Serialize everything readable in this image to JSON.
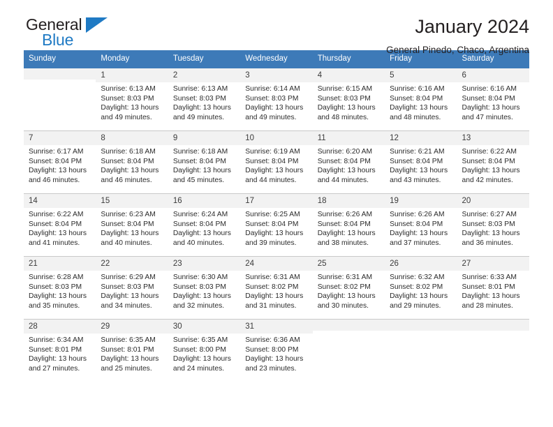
{
  "brand": {
    "name_top": "General",
    "name_bottom": "Blue",
    "accent_color": "#1f7ac4"
  },
  "header": {
    "title": "January 2024",
    "subtitle": "General Pinedo, Chaco, Argentina",
    "header_bg_color": "#3d7ab8",
    "daynum_bg_color": "#f2f2f2"
  },
  "weekdays": [
    "Sunday",
    "Monday",
    "Tuesday",
    "Wednesday",
    "Thursday",
    "Friday",
    "Saturday"
  ],
  "labels": {
    "sunrise_prefix": "Sunrise:",
    "sunset_prefix": "Sunset:",
    "daylight_prefix": "Daylight:"
  },
  "weeks": [
    [
      {
        "day": "",
        "sunrise": "",
        "sunset": "",
        "daylight_line1": "",
        "daylight_line2": "",
        "blank": true
      },
      {
        "day": "1",
        "sunrise": "Sunrise: 6:13 AM",
        "sunset": "Sunset: 8:03 PM",
        "daylight_line1": "Daylight: 13 hours",
        "daylight_line2": "and 49 minutes."
      },
      {
        "day": "2",
        "sunrise": "Sunrise: 6:13 AM",
        "sunset": "Sunset: 8:03 PM",
        "daylight_line1": "Daylight: 13 hours",
        "daylight_line2": "and 49 minutes."
      },
      {
        "day": "3",
        "sunrise": "Sunrise: 6:14 AM",
        "sunset": "Sunset: 8:03 PM",
        "daylight_line1": "Daylight: 13 hours",
        "daylight_line2": "and 49 minutes."
      },
      {
        "day": "4",
        "sunrise": "Sunrise: 6:15 AM",
        "sunset": "Sunset: 8:03 PM",
        "daylight_line1": "Daylight: 13 hours",
        "daylight_line2": "and 48 minutes."
      },
      {
        "day": "5",
        "sunrise": "Sunrise: 6:16 AM",
        "sunset": "Sunset: 8:04 PM",
        "daylight_line1": "Daylight: 13 hours",
        "daylight_line2": "and 48 minutes."
      },
      {
        "day": "6",
        "sunrise": "Sunrise: 6:16 AM",
        "sunset": "Sunset: 8:04 PM",
        "daylight_line1": "Daylight: 13 hours",
        "daylight_line2": "and 47 minutes."
      }
    ],
    [
      {
        "day": "7",
        "sunrise": "Sunrise: 6:17 AM",
        "sunset": "Sunset: 8:04 PM",
        "daylight_line1": "Daylight: 13 hours",
        "daylight_line2": "and 46 minutes."
      },
      {
        "day": "8",
        "sunrise": "Sunrise: 6:18 AM",
        "sunset": "Sunset: 8:04 PM",
        "daylight_line1": "Daylight: 13 hours",
        "daylight_line2": "and 46 minutes."
      },
      {
        "day": "9",
        "sunrise": "Sunrise: 6:18 AM",
        "sunset": "Sunset: 8:04 PM",
        "daylight_line1": "Daylight: 13 hours",
        "daylight_line2": "and 45 minutes."
      },
      {
        "day": "10",
        "sunrise": "Sunrise: 6:19 AM",
        "sunset": "Sunset: 8:04 PM",
        "daylight_line1": "Daylight: 13 hours",
        "daylight_line2": "and 44 minutes."
      },
      {
        "day": "11",
        "sunrise": "Sunrise: 6:20 AM",
        "sunset": "Sunset: 8:04 PM",
        "daylight_line1": "Daylight: 13 hours",
        "daylight_line2": "and 44 minutes."
      },
      {
        "day": "12",
        "sunrise": "Sunrise: 6:21 AM",
        "sunset": "Sunset: 8:04 PM",
        "daylight_line1": "Daylight: 13 hours",
        "daylight_line2": "and 43 minutes."
      },
      {
        "day": "13",
        "sunrise": "Sunrise: 6:22 AM",
        "sunset": "Sunset: 8:04 PM",
        "daylight_line1": "Daylight: 13 hours",
        "daylight_line2": "and 42 minutes."
      }
    ],
    [
      {
        "day": "14",
        "sunrise": "Sunrise: 6:22 AM",
        "sunset": "Sunset: 8:04 PM",
        "daylight_line1": "Daylight: 13 hours",
        "daylight_line2": "and 41 minutes."
      },
      {
        "day": "15",
        "sunrise": "Sunrise: 6:23 AM",
        "sunset": "Sunset: 8:04 PM",
        "daylight_line1": "Daylight: 13 hours",
        "daylight_line2": "and 40 minutes."
      },
      {
        "day": "16",
        "sunrise": "Sunrise: 6:24 AM",
        "sunset": "Sunset: 8:04 PM",
        "daylight_line1": "Daylight: 13 hours",
        "daylight_line2": "and 40 minutes."
      },
      {
        "day": "17",
        "sunrise": "Sunrise: 6:25 AM",
        "sunset": "Sunset: 8:04 PM",
        "daylight_line1": "Daylight: 13 hours",
        "daylight_line2": "and 39 minutes."
      },
      {
        "day": "18",
        "sunrise": "Sunrise: 6:26 AM",
        "sunset": "Sunset: 8:04 PM",
        "daylight_line1": "Daylight: 13 hours",
        "daylight_line2": "and 38 minutes."
      },
      {
        "day": "19",
        "sunrise": "Sunrise: 6:26 AM",
        "sunset": "Sunset: 8:04 PM",
        "daylight_line1": "Daylight: 13 hours",
        "daylight_line2": "and 37 minutes."
      },
      {
        "day": "20",
        "sunrise": "Sunrise: 6:27 AM",
        "sunset": "Sunset: 8:03 PM",
        "daylight_line1": "Daylight: 13 hours",
        "daylight_line2": "and 36 minutes."
      }
    ],
    [
      {
        "day": "21",
        "sunrise": "Sunrise: 6:28 AM",
        "sunset": "Sunset: 8:03 PM",
        "daylight_line1": "Daylight: 13 hours",
        "daylight_line2": "and 35 minutes."
      },
      {
        "day": "22",
        "sunrise": "Sunrise: 6:29 AM",
        "sunset": "Sunset: 8:03 PM",
        "daylight_line1": "Daylight: 13 hours",
        "daylight_line2": "and 34 minutes."
      },
      {
        "day": "23",
        "sunrise": "Sunrise: 6:30 AM",
        "sunset": "Sunset: 8:03 PM",
        "daylight_line1": "Daylight: 13 hours",
        "daylight_line2": "and 32 minutes."
      },
      {
        "day": "24",
        "sunrise": "Sunrise: 6:31 AM",
        "sunset": "Sunset: 8:02 PM",
        "daylight_line1": "Daylight: 13 hours",
        "daylight_line2": "and 31 minutes."
      },
      {
        "day": "25",
        "sunrise": "Sunrise: 6:31 AM",
        "sunset": "Sunset: 8:02 PM",
        "daylight_line1": "Daylight: 13 hours",
        "daylight_line2": "and 30 minutes."
      },
      {
        "day": "26",
        "sunrise": "Sunrise: 6:32 AM",
        "sunset": "Sunset: 8:02 PM",
        "daylight_line1": "Daylight: 13 hours",
        "daylight_line2": "and 29 minutes."
      },
      {
        "day": "27",
        "sunrise": "Sunrise: 6:33 AM",
        "sunset": "Sunset: 8:01 PM",
        "daylight_line1": "Daylight: 13 hours",
        "daylight_line2": "and 28 minutes."
      }
    ],
    [
      {
        "day": "28",
        "sunrise": "Sunrise: 6:34 AM",
        "sunset": "Sunset: 8:01 PM",
        "daylight_line1": "Daylight: 13 hours",
        "daylight_line2": "and 27 minutes."
      },
      {
        "day": "29",
        "sunrise": "Sunrise: 6:35 AM",
        "sunset": "Sunset: 8:01 PM",
        "daylight_line1": "Daylight: 13 hours",
        "daylight_line2": "and 25 minutes."
      },
      {
        "day": "30",
        "sunrise": "Sunrise: 6:35 AM",
        "sunset": "Sunset: 8:00 PM",
        "daylight_line1": "Daylight: 13 hours",
        "daylight_line2": "and 24 minutes."
      },
      {
        "day": "31",
        "sunrise": "Sunrise: 6:36 AM",
        "sunset": "Sunset: 8:00 PM",
        "daylight_line1": "Daylight: 13 hours",
        "daylight_line2": "and 23 minutes."
      },
      {
        "day": "",
        "sunrise": "",
        "sunset": "",
        "daylight_line1": "",
        "daylight_line2": "",
        "blank": true
      },
      {
        "day": "",
        "sunrise": "",
        "sunset": "",
        "daylight_line1": "",
        "daylight_line2": "",
        "blank": true
      },
      {
        "day": "",
        "sunrise": "",
        "sunset": "",
        "daylight_line1": "",
        "daylight_line2": "",
        "blank": true
      }
    ]
  ]
}
